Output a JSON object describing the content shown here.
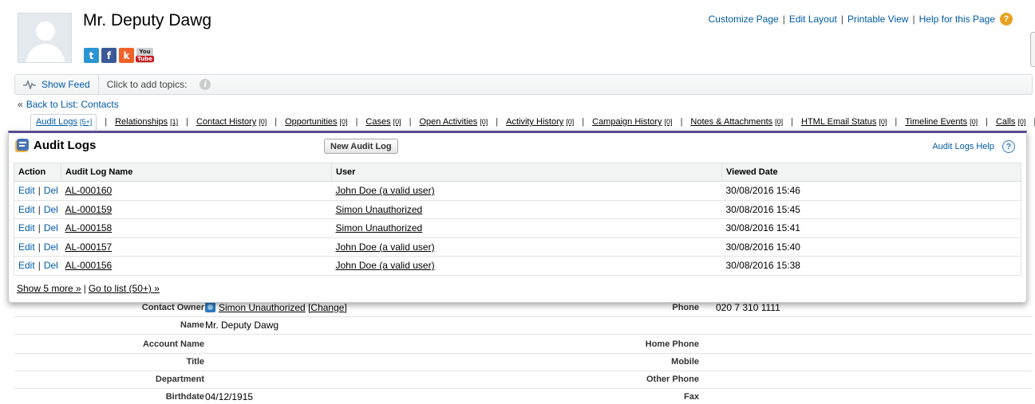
{
  "header": {
    "contact_name": "Mr. Deputy Dawg",
    "social": [
      {
        "icon": "twitter-icon",
        "glyph": "t"
      },
      {
        "icon": "facebook-icon",
        "glyph": "f"
      },
      {
        "icon": "klout-icon",
        "glyph": "k"
      }
    ],
    "youtube": {
      "top": "You",
      "bottom": "Tube"
    },
    "top_links": {
      "customize": "Customize Page",
      "edit_layout": "Edit Layout",
      "printable": "Printable View",
      "help": "Help for this Page",
      "sep": "|"
    }
  },
  "feed": {
    "show_feed": "Show Feed",
    "topics": "Click to add topics:",
    "info_glyph": "i"
  },
  "back_link": {
    "raquo": "«",
    "label": "Back to List: Contacts"
  },
  "related_tabs": [
    {
      "label": "Audit Logs",
      "count": "[5+]"
    },
    {
      "label": "Relationships",
      "count": "[1]"
    },
    {
      "label": "Contact History",
      "count": "[0]"
    },
    {
      "label": "Opportunities",
      "count": "[0]"
    },
    {
      "label": "Cases",
      "count": "[0]"
    },
    {
      "label": "Open Activities",
      "count": "[0]"
    },
    {
      "label": "Activity History",
      "count": "[0]"
    },
    {
      "label": "Campaign History",
      "count": "[0]"
    },
    {
      "label": "Notes & Attachments",
      "count": "[0]"
    },
    {
      "label": "HTML Email Status",
      "count": "[0]"
    },
    {
      "label": "Timeline Events",
      "count": "[0]"
    },
    {
      "label": "Calls",
      "count": "[0]"
    }
  ],
  "tab_sep": "|",
  "audit_popup": {
    "title": "Audit Logs",
    "new_button": "New Audit Log",
    "help_link": "Audit Logs Help",
    "help_glyph": "?",
    "columns": [
      "Action",
      "Audit Log Name",
      "User",
      "Viewed Date"
    ],
    "edit_label": "Edit",
    "del_label": "Del",
    "pipe": "|",
    "rows": [
      {
        "name": "AL-000160",
        "user": "John Doe (a valid user)",
        "date": "30/08/2016 15:46"
      },
      {
        "name": "AL-000159",
        "user": "Simon Unauthorized",
        "date": "30/08/2016 15:45"
      },
      {
        "name": "AL-000158",
        "user": "Simon Unauthorized",
        "date": "30/08/2016 15:41"
      },
      {
        "name": "AL-000157",
        "user": "John Doe (a valid user)",
        "date": "30/08/2016 15:40"
      },
      {
        "name": "AL-000156",
        "user": "John Doe (a valid user)",
        "date": "30/08/2016 15:38"
      }
    ],
    "show_more": "Show 5 more »",
    "go_to_list": "Go to list (50+) »"
  },
  "detail": {
    "owner_label": "Contact Owner",
    "owner_value": "Simon Unauthorized",
    "owner_change": "[Change]",
    "phone_label": "Phone",
    "phone_value": "020 7 310 1111",
    "name_label": "Name",
    "name_value": "Mr. Deputy Dawg",
    "account_label": "Account Name",
    "home_phone_label": "Home Phone",
    "title_label": "Title",
    "mobile_label": "Mobile",
    "department_label": "Department",
    "other_phone_label": "Other Phone",
    "birthdate_label": "Birthdate",
    "birthdate_value": "04/12/1915",
    "fax_label": "Fax"
  },
  "colors": {
    "link": "#015ba7",
    "popup_accent": "#5b4b91",
    "help_orange": "#e8a11f"
  }
}
